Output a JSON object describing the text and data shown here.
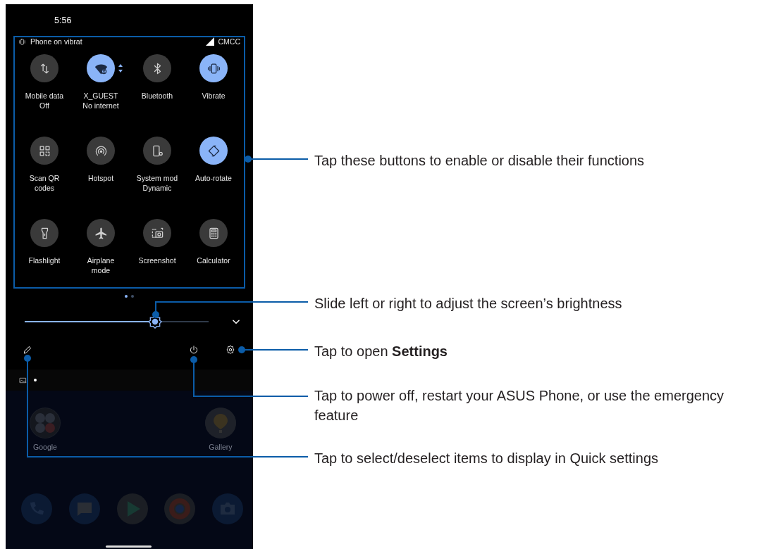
{
  "status_bar": {
    "time": "5:56"
  },
  "quick_settings": {
    "notice": "Phone on vibrat",
    "carrier": "CMCC",
    "tiles": [
      {
        "kind": "data",
        "label": "Mobile data",
        "sublabel": "Off",
        "on": false
      },
      {
        "kind": "wifi",
        "label": "X_GUEST",
        "sublabel": "No internet",
        "on": true
      },
      {
        "kind": "bluetooth",
        "label": "Bluetooth",
        "on": false
      },
      {
        "kind": "vibrate",
        "label": "Vibrate",
        "on": true
      },
      {
        "kind": "qr",
        "label": "Scan QR",
        "sublabel": "codes",
        "on": false
      },
      {
        "kind": "hotspot",
        "label": "Hotspot",
        "on": false
      },
      {
        "kind": "system",
        "label": "System mod",
        "sublabel": "Dynamic",
        "on": false
      },
      {
        "kind": "rotate",
        "label": "Auto-rotate",
        "on": true
      },
      {
        "kind": "flashlight",
        "label": "Flashlight",
        "on": false
      },
      {
        "kind": "airplane",
        "label": "Airplane",
        "sublabel": "mode",
        "on": false
      },
      {
        "kind": "screenshot",
        "label": "Screenshot",
        "on": false
      },
      {
        "kind": "calculator",
        "label": "Calculator",
        "on": false
      }
    ]
  },
  "page_indicator": [
    {
      "selected": true
    },
    {
      "selected": false
    }
  ],
  "brightness": {
    "level": 0.71
  },
  "home_apps": [
    {
      "label": "Google"
    },
    {
      "label": "Gallery"
    }
  ],
  "callouts": [
    {
      "text": "Tap these buttons to enable or disable their functions"
    },
    {
      "text": "Slide left or right to adjust the screen’s brightness"
    },
    {
      "text": "Tap to open **Settings**"
    },
    {
      "text": "Tap to power off, restart your ASUS Phone, or use the emergency feature"
    },
    {
      "text": "Tap to select/deselect items to display in Quick settings"
    }
  ]
}
